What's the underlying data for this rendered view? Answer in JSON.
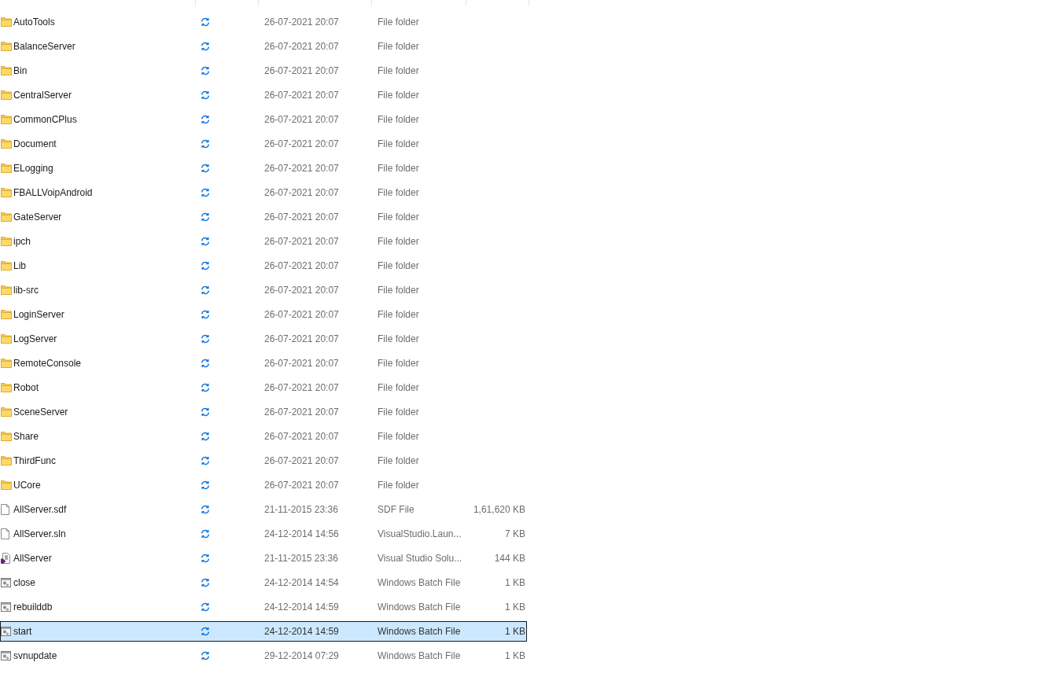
{
  "file_list": {
    "rows": [
      {
        "name": "AutoTools",
        "kind": "folder",
        "date": "26-07-2021 20:07",
        "type": "File folder",
        "selected": false
      },
      {
        "name": "BalanceServer",
        "kind": "folder",
        "date": "26-07-2021 20:07",
        "type": "File folder",
        "selected": false
      },
      {
        "name": "Bin",
        "kind": "folder",
        "date": "26-07-2021 20:07",
        "type": "File folder",
        "selected": false
      },
      {
        "name": "CentralServer",
        "kind": "folder",
        "date": "26-07-2021 20:07",
        "type": "File folder",
        "selected": false
      },
      {
        "name": "CommonCPlus",
        "kind": "folder",
        "date": "26-07-2021 20:07",
        "type": "File folder",
        "selected": false
      },
      {
        "name": "Document",
        "kind": "folder",
        "date": "26-07-2021 20:07",
        "type": "File folder",
        "selected": false
      },
      {
        "name": "ELogging",
        "kind": "folder",
        "date": "26-07-2021 20:07",
        "type": "File folder",
        "selected": false
      },
      {
        "name": "FBALLVoipAndroid",
        "kind": "folder",
        "date": "26-07-2021 20:07",
        "type": "File folder",
        "selected": false
      },
      {
        "name": "GateServer",
        "kind": "folder",
        "date": "26-07-2021 20:07",
        "type": "File folder",
        "selected": false
      },
      {
        "name": "ipch",
        "kind": "folder",
        "date": "26-07-2021 20:07",
        "type": "File folder",
        "selected": false
      },
      {
        "name": "Lib",
        "kind": "folder",
        "date": "26-07-2021 20:07",
        "type": "File folder",
        "selected": false
      },
      {
        "name": "lib-src",
        "kind": "folder",
        "date": "26-07-2021 20:07",
        "type": "File folder",
        "selected": false
      },
      {
        "name": "LoginServer",
        "kind": "folder",
        "date": "26-07-2021 20:07",
        "type": "File folder",
        "selected": false
      },
      {
        "name": "LogServer",
        "kind": "folder",
        "date": "26-07-2021 20:07",
        "type": "File folder",
        "selected": false
      },
      {
        "name": "RemoteConsole",
        "kind": "folder",
        "date": "26-07-2021 20:07",
        "type": "File folder",
        "selected": false
      },
      {
        "name": "Robot",
        "kind": "folder",
        "date": "26-07-2021 20:07",
        "type": "File folder",
        "selected": false
      },
      {
        "name": "SceneServer",
        "kind": "folder",
        "date": "26-07-2021 20:07",
        "type": "File folder",
        "selected": false
      },
      {
        "name": "Share",
        "kind": "folder",
        "date": "26-07-2021 20:07",
        "type": "File folder",
        "selected": false
      },
      {
        "name": "ThirdFunc",
        "kind": "folder",
        "date": "26-07-2021 20:07",
        "type": "File folder",
        "selected": false
      },
      {
        "name": "UCore",
        "kind": "folder",
        "date": "26-07-2021 20:07",
        "type": "File folder",
        "selected": false
      },
      {
        "name": "AllServer.sdf",
        "kind": "file",
        "date": "21-11-2015 23:36",
        "type": "SDF File",
        "size": "1,61,620 KB",
        "selected": false
      },
      {
        "name": "AllServer.sln",
        "kind": "file",
        "date": "24-12-2014 14:56",
        "type": "VisualStudio.Laun...",
        "size": "7 KB",
        "selected": false
      },
      {
        "name": "AllServer",
        "kind": "solution",
        "date": "21-11-2015 23:36",
        "type": "Visual Studio Solu...",
        "size": "144 KB",
        "selected": false
      },
      {
        "name": "close",
        "kind": "batch",
        "date": "24-12-2014 14:54",
        "type": "Windows Batch File",
        "size": "1 KB",
        "selected": false
      },
      {
        "name": "rebuilddb",
        "kind": "batch",
        "date": "24-12-2014 14:59",
        "type": "Windows Batch File",
        "size": "1 KB",
        "selected": false
      },
      {
        "name": "start",
        "kind": "batch",
        "date": "24-12-2014 14:59",
        "type": "Windows Batch File",
        "size": "1 KB",
        "selected": true
      },
      {
        "name": "svnupdate",
        "kind": "batch",
        "date": "29-12-2014 07:29",
        "type": "Windows Batch File",
        "size": "1 KB",
        "selected": false
      }
    ]
  }
}
